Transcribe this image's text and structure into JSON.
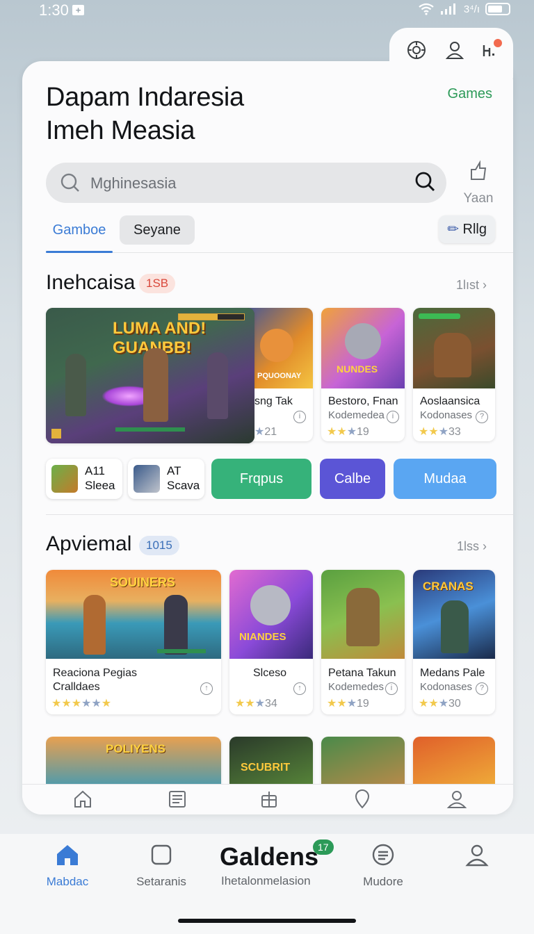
{
  "status_bar": {
    "time": "1:30",
    "time_badge": "+",
    "signal_text": "3⁴/ı"
  },
  "header": {
    "title_line1": "Dapam Indaresia",
    "title_line2": "Imeh Measia",
    "games_link": "Games"
  },
  "search": {
    "placeholder": "Mghinesasia",
    "share_label": "Yaan"
  },
  "tabs": {
    "active": "Gamboe",
    "pill": "Seyane",
    "right": "Rllg"
  },
  "section1": {
    "title": "Inehcaisa",
    "badge": "1SB",
    "more": "1lıst",
    "featured_banner": "LUMA AND! GUANBB!",
    "games": [
      {
        "name": "sng Tak",
        "sub": "",
        "rating": "21",
        "art_title": "PQUOONAY"
      },
      {
        "name": "Bestoro, Fnan",
        "sub": "Kodemedea",
        "rating": "19",
        "art_title": "NUNDES"
      },
      {
        "name": "Aoslaansica",
        "sub": "Kodonases",
        "rating": "33",
        "art_title": ""
      }
    ]
  },
  "quick_row": {
    "apps": [
      {
        "line1": "A11",
        "line2": "Sleea"
      },
      {
        "line1": "AT",
        "line2": "Scava"
      }
    ],
    "buttons": [
      {
        "label": "Frqpus",
        "color": "#36b27a"
      },
      {
        "label": "Calbe",
        "color": "#5b55d6"
      },
      {
        "label": "Mudaa",
        "color": "#5aa6f2"
      }
    ]
  },
  "section2": {
    "title": "Apviemal",
    "badge": "1015",
    "more": "1lss",
    "games": [
      {
        "name": "Reaciona Pegias",
        "sub": "Cralldaes",
        "rating": "",
        "art_title": "SOUINERS"
      },
      {
        "name": "Slceso",
        "sub": "",
        "rating": "34",
        "art_title": "NIANDES"
      },
      {
        "name": "Petana Takun",
        "sub": "Kodemedes",
        "rating": "19",
        "art_title": ""
      },
      {
        "name": "Medans Pale",
        "sub": "Kodonases",
        "rating": "30",
        "art_title": "CRANAS"
      }
    ],
    "row3_titles": [
      "POLIYENS",
      "SCUBRIT"
    ]
  },
  "bottom_nav": {
    "items": [
      {
        "label": "Mabdac",
        "icon": "home-icon"
      },
      {
        "label": "Setaranis",
        "icon": "square-icon"
      },
      {
        "label": "Mudore",
        "icon": "list-circle-icon"
      },
      {
        "label": "",
        "icon": "profile-icon"
      }
    ],
    "center_title": "Galdens",
    "center_badge": "17",
    "center_sub": "Ihetalonmelasion",
    "active_color": "#3a7bd5"
  }
}
